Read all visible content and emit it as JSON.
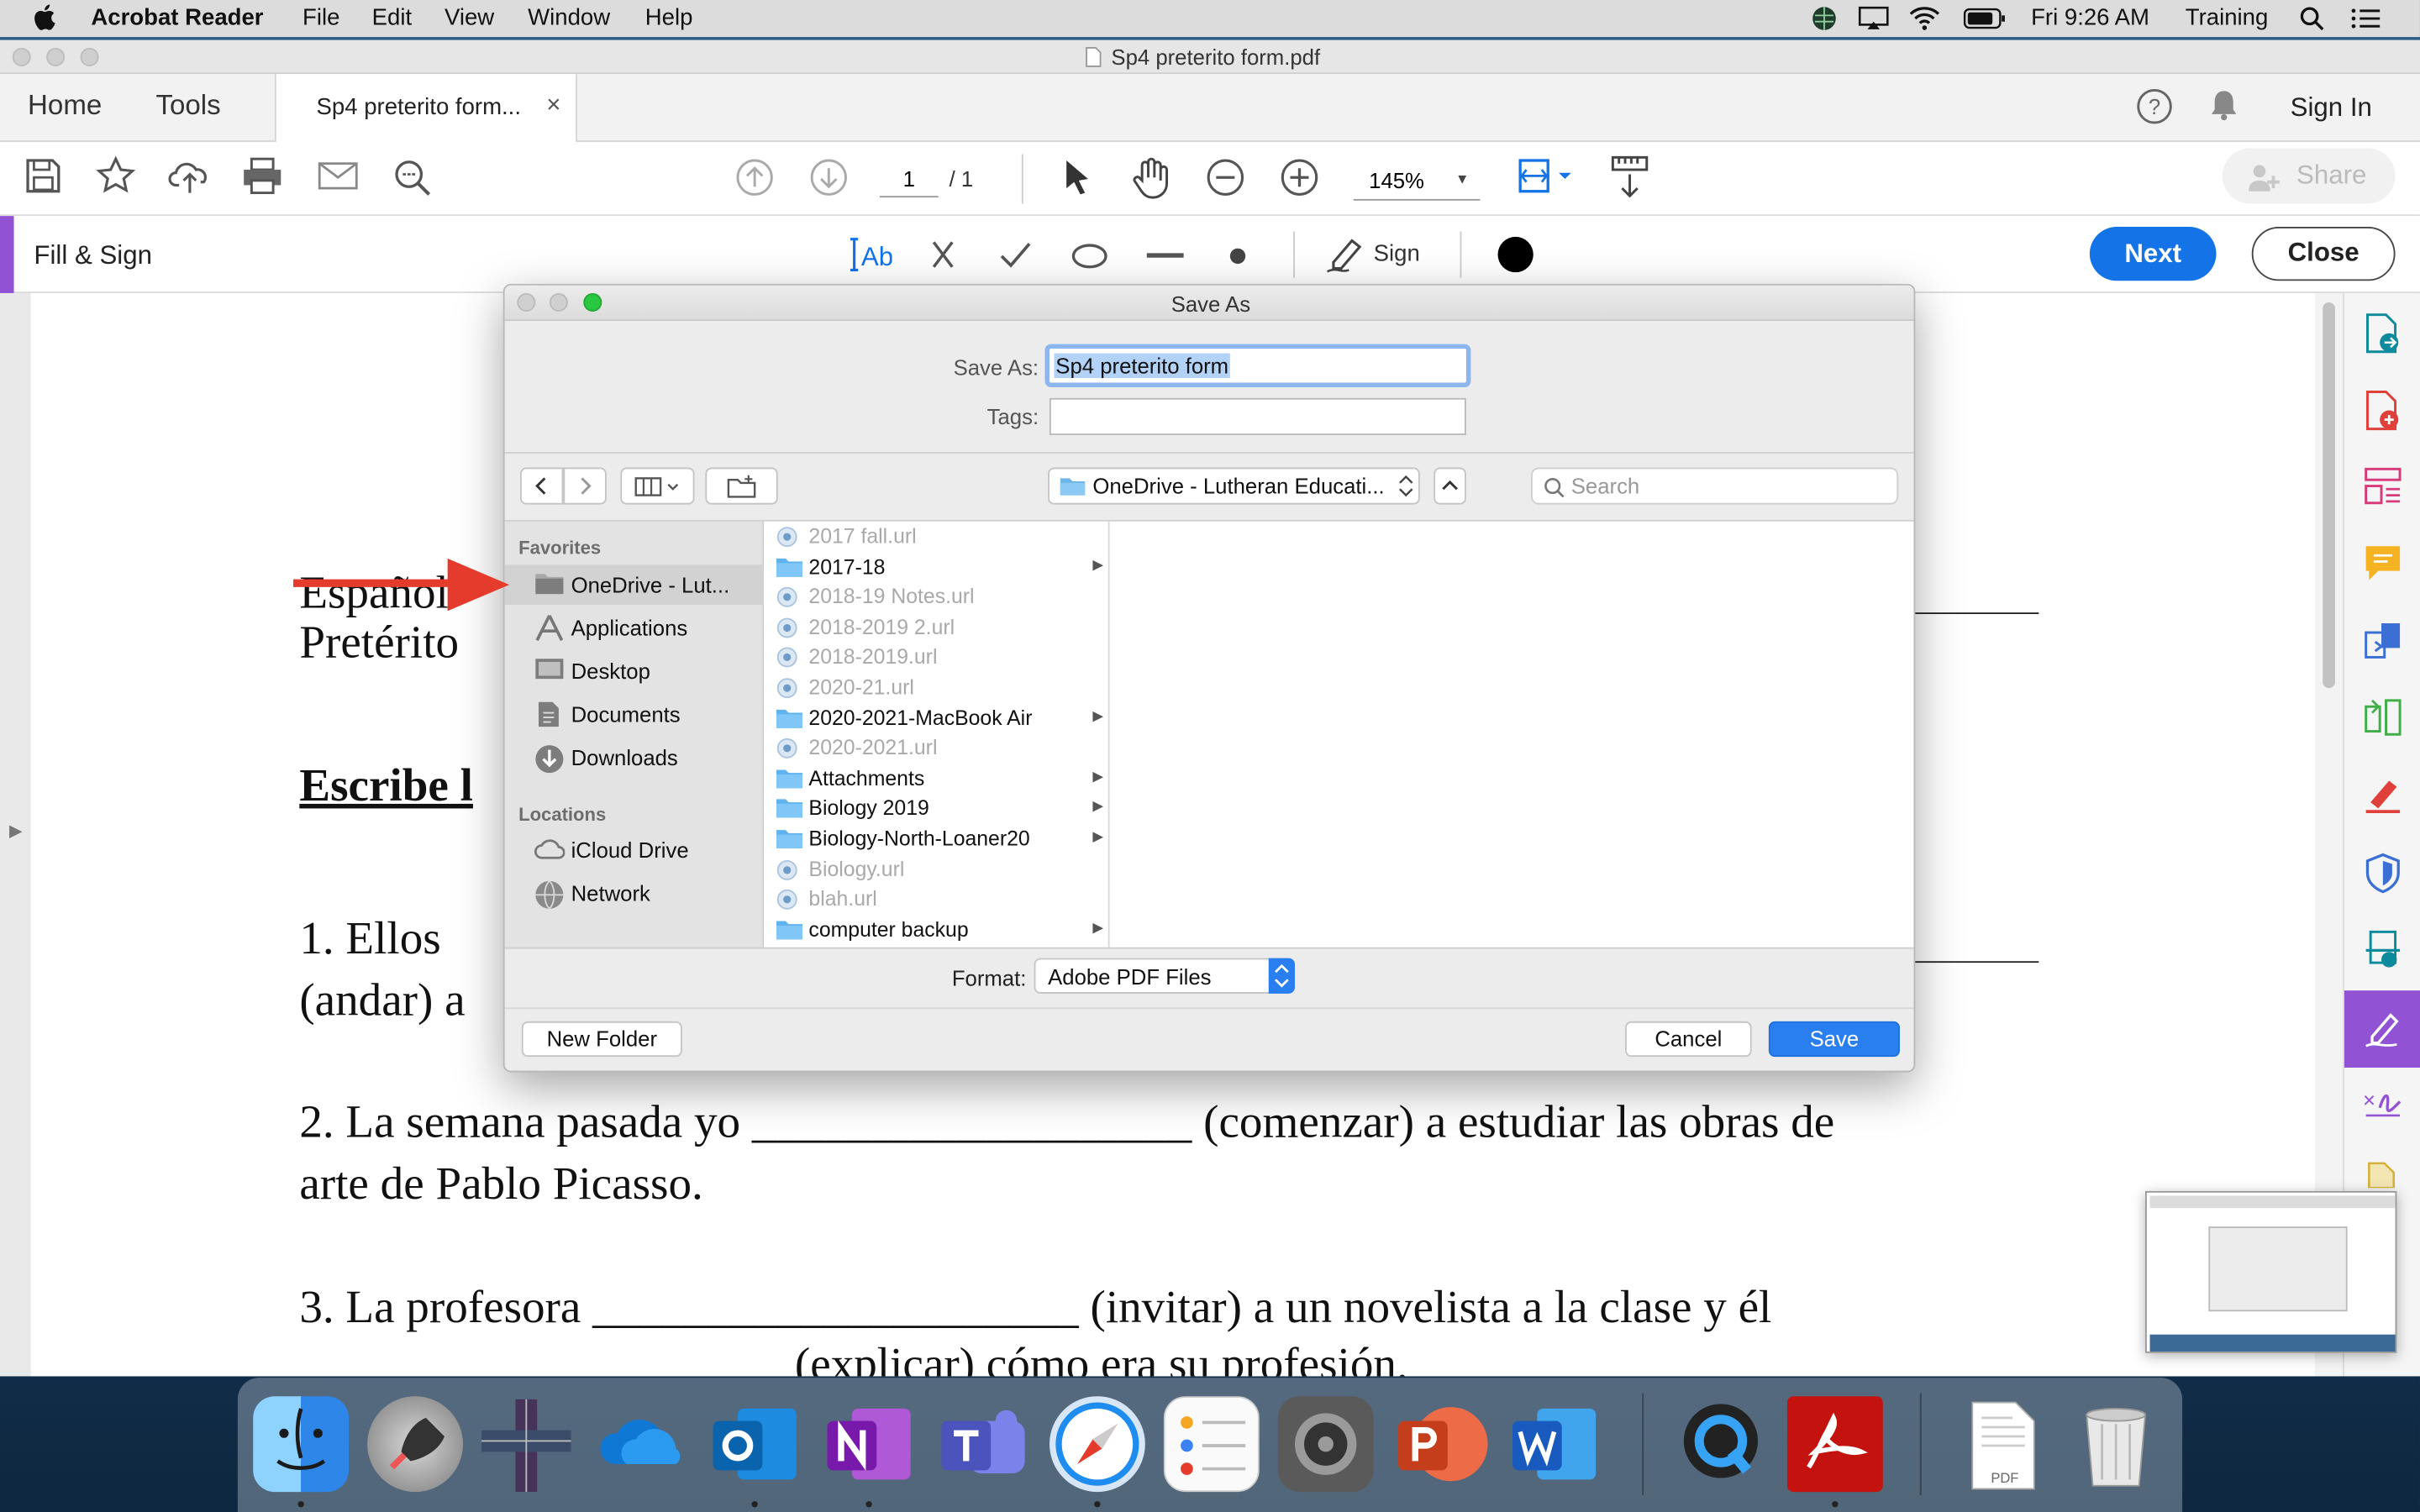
{
  "menubar": {
    "app_name": "Acrobat Reader",
    "items": [
      "File",
      "Edit",
      "View",
      "Window",
      "Help"
    ],
    "clock": "Fri 9:26 AM",
    "user": "Training"
  },
  "window": {
    "title": "Sp4 preterito form.pdf"
  },
  "tabs": {
    "home": "Home",
    "tools": "Tools",
    "document": "Sp4 preterito form...",
    "sign_in": "Sign In"
  },
  "toolbar": {
    "page_current": "1",
    "page_total": "/ 1",
    "zoom": "145%",
    "share": "Share"
  },
  "fill_sign": {
    "title": "Fill & Sign",
    "sign_label": "Sign",
    "next": "Next",
    "close": "Close"
  },
  "document": {
    "line1": "Español",
    "line2": "Pretérito",
    "heading": "Escribe l",
    "q1a": "1. Ellos ",
    "q1b": "(andar) a",
    "q2a": "2.  La semana pasada yo ___________________ (comenzar) a estudiar las obras de",
    "q2b": "arte de Pablo Picasso.",
    "q3a": "3. La profesora _____________________ (invitar) a un novelista a la clase y él",
    "q3b": "(explicar) cómo era su profesión."
  },
  "dialog": {
    "title": "Save As",
    "save_as_label": "Save As:",
    "save_as_value": "Sp4 preterito form",
    "tags_label": "Tags:",
    "location": "OneDrive - Lutheran Educati...",
    "search_placeholder": "Search",
    "format_label": "Format:",
    "format_value": "Adobe PDF Files",
    "new_folder": "New Folder",
    "cancel": "Cancel",
    "save": "Save"
  },
  "sidebar": {
    "favorites_header": "Favorites",
    "favorites": [
      "OneDrive - Lut...",
      "Applications",
      "Desktop",
      "Documents",
      "Downloads"
    ],
    "locations_header": "Locations",
    "locations": [
      "iCloud Drive",
      "Network"
    ]
  },
  "files": [
    {
      "name": "2017 fall.url",
      "kind": "url"
    },
    {
      "name": "2017-18",
      "kind": "folder"
    },
    {
      "name": "2018-19 Notes.url",
      "kind": "url"
    },
    {
      "name": "2018-2019 2.url",
      "kind": "url"
    },
    {
      "name": "2018-2019.url",
      "kind": "url"
    },
    {
      "name": "2020-21.url",
      "kind": "url"
    },
    {
      "name": "2020-2021-MacBook Air",
      "kind": "folder"
    },
    {
      "name": "2020-2021.url",
      "kind": "url"
    },
    {
      "name": "Attachments",
      "kind": "folder"
    },
    {
      "name": "Biology 2019",
      "kind": "folder"
    },
    {
      "name": "Biology-North-Loaner20",
      "kind": "folder"
    },
    {
      "name": "Biology.url",
      "kind": "url"
    },
    {
      "name": "blah.url",
      "kind": "url"
    },
    {
      "name": "computer backup",
      "kind": "folder"
    }
  ],
  "dock": {
    "pdf_label": "PDF"
  },
  "colors": {
    "accent": "#1473e6",
    "save_blue": "#2a7ff0",
    "purple": "#9252d4",
    "arrow_red": "#e53b2c"
  }
}
